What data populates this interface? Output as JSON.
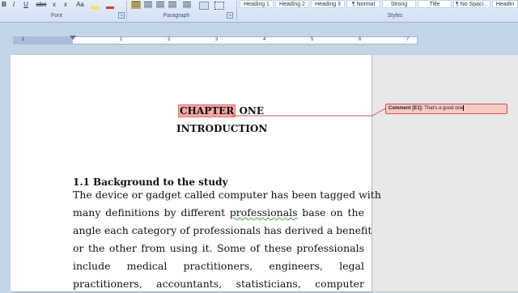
{
  "ribbon": {
    "font_buttons": [
      "B",
      "I",
      "U",
      "abc",
      "x",
      "x",
      "Aa"
    ],
    "font_group_label": "Font",
    "paragraph_group_label": "Paragraph",
    "styles_group_label": "Styles",
    "styles": [
      "Heading 1",
      "Heading 2",
      "Heading 3",
      "¶ Normal",
      "Strong",
      "Title",
      "¶ No Spaci...",
      "Headin"
    ]
  },
  "ruler": {
    "numbers": [
      "1",
      "1",
      "2",
      "3",
      "4",
      "5",
      "6",
      "7"
    ]
  },
  "document": {
    "chapter_word": "CHAPTER",
    "chapter_rest": " ONE",
    "intro": "INTRODUCTION",
    "section_heading": "1.1 Background to the study",
    "body_lines": [
      "The device or gadget called computer has been tagged with",
      [
        "many definitions by different ",
        "professionals",
        " base on the"
      ],
      "angle each category of professionals has derived a benefit",
      "or the other from using it. Some of these professionals",
      "include medical practitioners, engineers, legal",
      "practitioners, accountants, statisticians, computer"
    ]
  },
  "comment": {
    "label": "Comment [E1]:",
    "text": "That's a good one"
  },
  "colors": {
    "comment_highlight": "#f4a8a8",
    "comment_border": "#d9534f",
    "ribbon_bg": "#d2e1f3",
    "spelling_squiggle": "#3fa33f"
  }
}
